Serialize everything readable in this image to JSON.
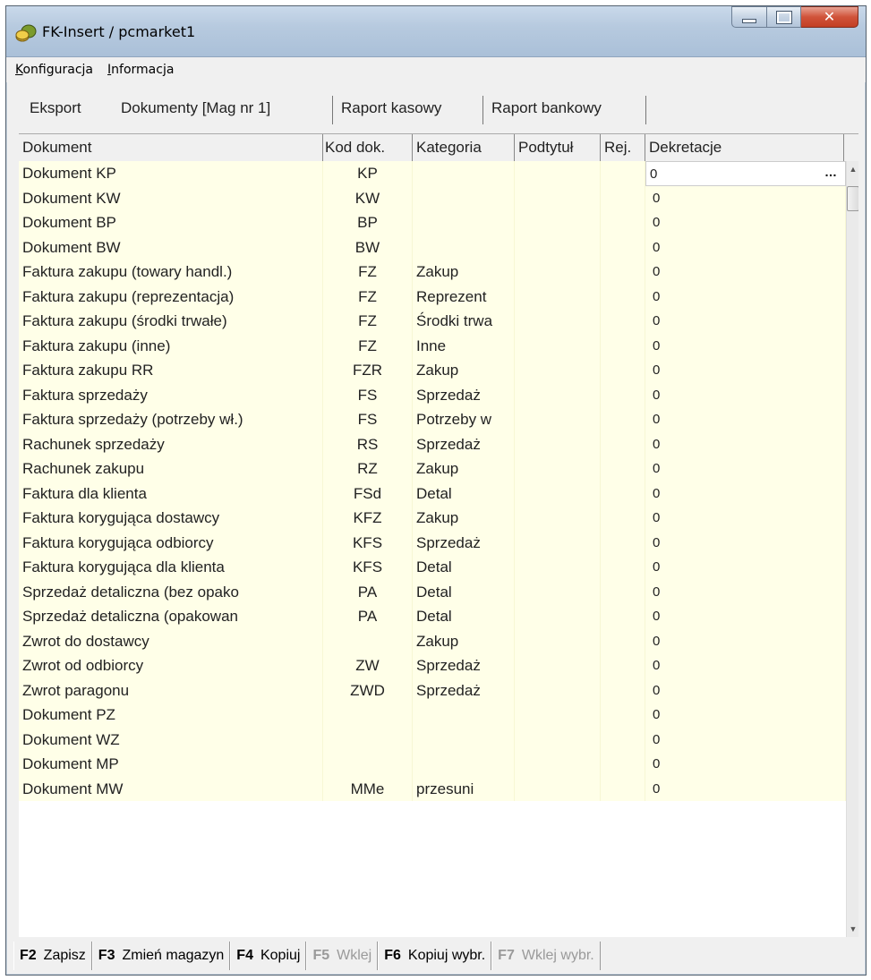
{
  "window": {
    "title": "FK-Insert / pcmarket1",
    "app_icon": "money-coins-icon"
  },
  "menu": {
    "items": [
      {
        "label": "Konfiguracja",
        "hotkey": "K"
      },
      {
        "label": "Informacja",
        "hotkey": "I"
      }
    ]
  },
  "tabs": [
    {
      "label": "Eksport",
      "active": false
    },
    {
      "label": "Dokumenty [Mag nr 1]",
      "active": true
    },
    {
      "label": "Raport kasowy",
      "active": false
    },
    {
      "label": "Raport bankowy",
      "active": false
    }
  ],
  "grid": {
    "columns": [
      "Dokument",
      "Kod dok.",
      "Kategoria",
      "Podtytuł",
      "Rej.",
      "Dekretacje"
    ],
    "selected_row": 0,
    "rows": [
      [
        "Dokument KP",
        "KP",
        "",
        "",
        "",
        "0"
      ],
      [
        "Dokument KW",
        "KW",
        "",
        "",
        "",
        "0"
      ],
      [
        "Dokument BP",
        "BP",
        "",
        "",
        "",
        "0"
      ],
      [
        "Dokument BW",
        "BW",
        "",
        "",
        "",
        "0"
      ],
      [
        "Faktura zakupu (towary handl.)",
        "FZ",
        "Zakup",
        "",
        "",
        "0"
      ],
      [
        "Faktura zakupu (reprezentacja)",
        "FZ",
        "Reprezent",
        "",
        "",
        "0"
      ],
      [
        "Faktura zakupu (środki trwałe)",
        "FZ",
        "Środki trwa",
        "",
        "",
        "0"
      ],
      [
        "Faktura zakupu (inne)",
        "FZ",
        "Inne",
        "",
        "",
        "0"
      ],
      [
        "Faktura zakupu RR",
        "FZR",
        "Zakup",
        "",
        "",
        "0"
      ],
      [
        "Faktura sprzedaży",
        "FS",
        "Sprzedaż",
        "",
        "",
        "0"
      ],
      [
        "Faktura sprzedaży (potrzeby wł.)",
        "FS",
        "Potrzeby w",
        "",
        "",
        "0"
      ],
      [
        "Rachunek sprzedaży",
        "RS",
        "Sprzedaż",
        "",
        "",
        "0"
      ],
      [
        "Rachunek zakupu",
        "RZ",
        "Zakup",
        "",
        "",
        "0"
      ],
      [
        "Faktura dla klienta",
        "FSd",
        "Detal",
        "",
        "",
        "0"
      ],
      [
        "Faktura korygująca dostawcy",
        "KFZ",
        "Zakup",
        "",
        "",
        "0"
      ],
      [
        "Faktura korygująca odbiorcy",
        "KFS",
        "Sprzedaż",
        "",
        "",
        "0"
      ],
      [
        "Faktura korygująca dla klienta",
        "KFS",
        "Detal",
        "",
        "",
        "0"
      ],
      [
        "Sprzedaż detaliczna (bez opako",
        "PA",
        "Detal",
        "",
        "",
        "0"
      ],
      [
        "Sprzedaż detaliczna (opakowan",
        "PA",
        "Detal",
        "",
        "",
        "0"
      ],
      [
        "Zwrot do dostawcy",
        "",
        "Zakup",
        "",
        "",
        "0"
      ],
      [
        "Zwrot od odbiorcy",
        "ZW",
        "Sprzedaż",
        "",
        "",
        "0"
      ],
      [
        "Zwrot paragonu",
        "ZWD",
        "Sprzedaż",
        "",
        "",
        "0"
      ],
      [
        "Dokument PZ",
        "",
        "",
        "",
        "",
        "0"
      ],
      [
        "Dokument WZ",
        "",
        "",
        "",
        "",
        "0"
      ],
      [
        "Dokument MP",
        "",
        "",
        "",
        "",
        "0"
      ],
      [
        "Dokument MW",
        "MMe",
        "przesuni",
        "",
        "",
        "0"
      ]
    ]
  },
  "fkeys": [
    {
      "key": "F2",
      "label": "Zapisz",
      "enabled": true
    },
    {
      "key": "F3",
      "label": "Zmień magazyn",
      "enabled": true
    },
    {
      "key": "F4",
      "label": "Kopiuj",
      "enabled": true
    },
    {
      "key": "F5",
      "label": "Wklej",
      "enabled": false
    },
    {
      "key": "F6",
      "label": "Kopiuj wybr.",
      "enabled": true
    },
    {
      "key": "F7",
      "label": "Wklej wybr.",
      "enabled": false
    }
  ],
  "colors": {
    "row_bg": "#ffffe8",
    "close_button": "#c33f24"
  }
}
